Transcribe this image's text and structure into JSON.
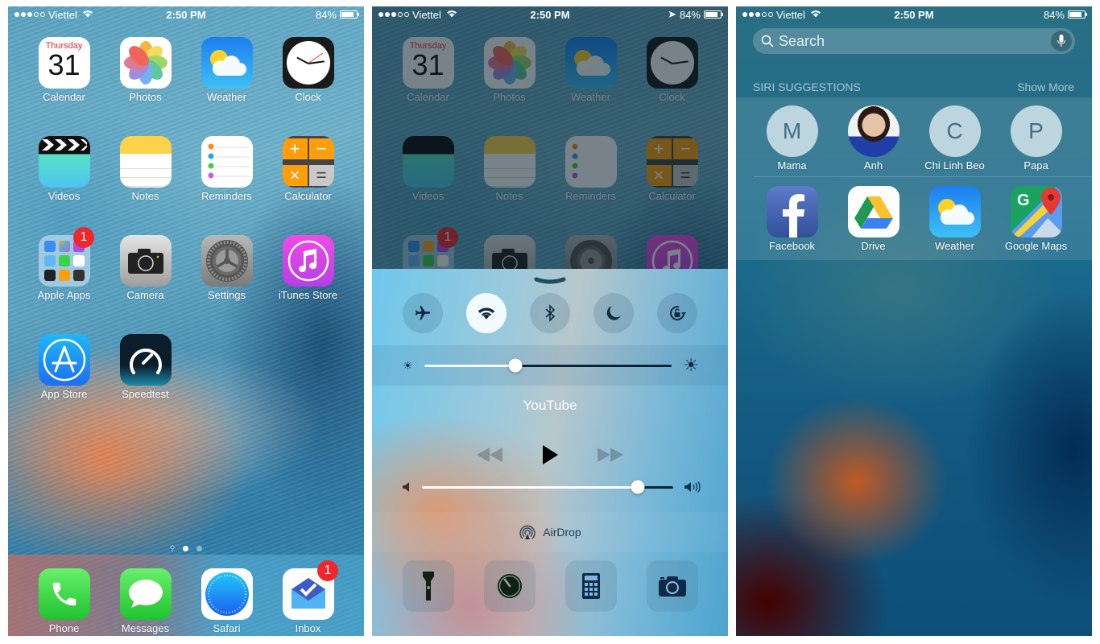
{
  "status_bar": {
    "carrier": "Viettel",
    "signal_bars": 3,
    "signal_max": 5,
    "time": "2:50 PM",
    "battery": "84%",
    "battery_fraction": 0.84
  },
  "home": {
    "apps": [
      {
        "label": "Calendar",
        "icon": "calendar-icon",
        "day": "Thursday",
        "date": "31"
      },
      {
        "label": "Photos",
        "icon": "photos-icon"
      },
      {
        "label": "Weather",
        "icon": "weather-icon"
      },
      {
        "label": "Clock",
        "icon": "clock-icon"
      },
      {
        "label": "Videos",
        "icon": "videos-icon"
      },
      {
        "label": "Notes",
        "icon": "notes-icon"
      },
      {
        "label": "Reminders",
        "icon": "reminders-icon"
      },
      {
        "label": "Calculator",
        "icon": "calculator-icon"
      },
      {
        "label": "Apple Apps",
        "icon": "folder-icon",
        "badge": "1"
      },
      {
        "label": "Camera",
        "icon": "camera-icon"
      },
      {
        "label": "Settings",
        "icon": "settings-icon"
      },
      {
        "label": "iTunes Store",
        "icon": "itunes-icon"
      },
      {
        "label": "App Store",
        "icon": "app-store-icon"
      },
      {
        "label": "Speedtest",
        "icon": "speedtest-icon"
      }
    ],
    "page_dots": {
      "count": 2,
      "active": 0,
      "has_search": true
    },
    "dock": [
      {
        "label": "Phone",
        "icon": "phone-icon"
      },
      {
        "label": "Messages",
        "icon": "messages-icon"
      },
      {
        "label": "Safari",
        "icon": "safari-icon"
      },
      {
        "label": "Inbox",
        "icon": "inbox-icon",
        "badge": "1"
      }
    ]
  },
  "control_center": {
    "toggles": [
      {
        "name": "airplane-mode",
        "icon": "airplane-icon",
        "on": false
      },
      {
        "name": "wifi",
        "icon": "wifi-icon",
        "on": true
      },
      {
        "name": "bluetooth",
        "icon": "bluetooth-icon",
        "on": false
      },
      {
        "name": "do-not-disturb",
        "icon": "moon-icon",
        "on": false
      },
      {
        "name": "rotation-lock",
        "icon": "rotation-lock-icon",
        "on": false
      }
    ],
    "brightness": 0.37,
    "now_playing": "YouTube",
    "volume": 0.86,
    "airdrop_label": "AirDrop",
    "shortcuts": [
      {
        "name": "flashlight",
        "icon": "flashlight-icon"
      },
      {
        "name": "timer",
        "icon": "timer-icon"
      },
      {
        "name": "calculator",
        "icon": "calculator-icon"
      },
      {
        "name": "camera",
        "icon": "camera-icon"
      }
    ]
  },
  "spotlight": {
    "search_placeholder": "Search",
    "siri_header": "SIRI SUGGESTIONS",
    "show_more": "Show More",
    "contacts": [
      {
        "name": "Mama",
        "initial": "M"
      },
      {
        "name": "Anh",
        "initial": "",
        "photo": true
      },
      {
        "name": "Chi Linh Beo",
        "initial": "C"
      },
      {
        "name": "Papa",
        "initial": "P"
      }
    ],
    "apps": [
      {
        "label": "Facebook",
        "icon": "facebook-icon"
      },
      {
        "label": "Drive",
        "icon": "google-drive-icon"
      },
      {
        "label": "Weather",
        "icon": "weather-icon"
      },
      {
        "label": "Google Maps",
        "icon": "google-maps-icon"
      }
    ]
  },
  "colors": {
    "badge": "#f0262c",
    "wifi_on": "#f2fbff"
  }
}
